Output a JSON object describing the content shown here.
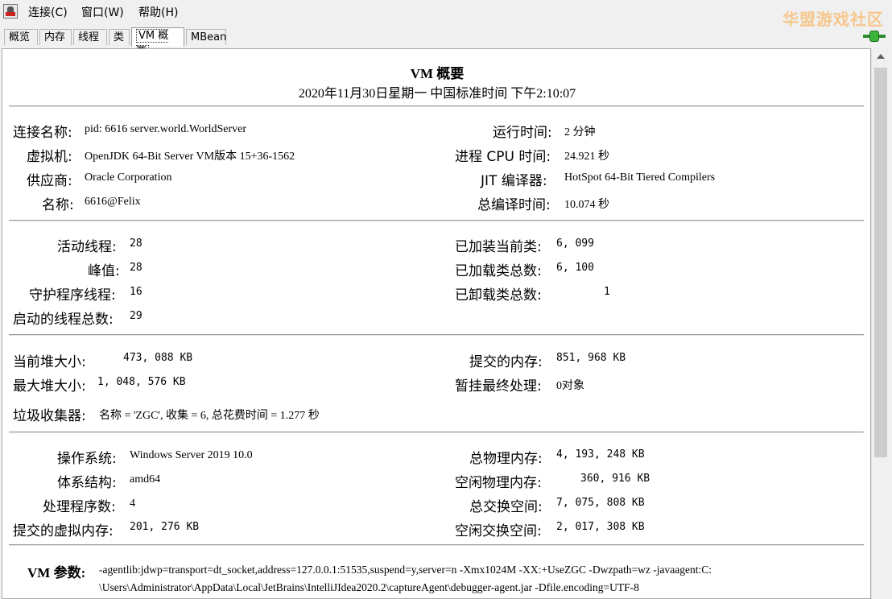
{
  "menu": {
    "items": [
      "连接(C)",
      "窗口(W)",
      "帮助(H)"
    ],
    "watermark": "华盟游戏社区"
  },
  "tabs": [
    "概览",
    "内存",
    "线程",
    "类",
    "VM 概要",
    "MBean"
  ],
  "active_tab": "VM 概要",
  "summary": {
    "title": "VM 概要",
    "timestamp": "2020年11月30日星期一 中国标准时间 下午2:10:07",
    "vm": {
      "connection_name_label": "连接名称:",
      "connection_name": "pid: 6616 server.world.WorldServer",
      "vm_label": "虚拟机:",
      "vm": "OpenJDK 64-Bit Server VM版本 15+36-1562",
      "vendor_label": "供应商:",
      "vendor": "Oracle Corporation",
      "name_label": "名称:",
      "name": "6616@Felix",
      "uptime_label": "运行时间:",
      "uptime": "2 分钟",
      "process_cpu_label": "进程 CPU 时间:",
      "process_cpu": "24.921 秒",
      "jit_label": "JIT 编译器:",
      "jit": "HotSpot 64-Bit Tiered Compilers",
      "compile_time_label": "总编译时间:",
      "compile_time": "10.074 秒"
    },
    "threads": {
      "live_label": "活动线程:",
      "live": "28",
      "peak_label": "峰值:",
      "peak": "28",
      "daemon_label": "守护程序线程:",
      "daemon": "16",
      "started_label": "启动的线程总数:",
      "started": "29",
      "loaded_label": "已加装当前类:",
      "loaded": "6, 099",
      "total_loaded_label": "已加载类总数:",
      "total_loaded": "6, 100",
      "unloaded_label": "已卸载类总数:",
      "unloaded": "1"
    },
    "memory": {
      "heap_label": "当前堆大小:",
      "heap": "473, 088 KB",
      "max_heap_label": "最大堆大小:",
      "max_heap": "1, 048, 576 KB",
      "committed_label": "提交的内存:",
      "committed": "851, 968 KB",
      "pending_label": "暂挂最终处理:",
      "pending": "0对象",
      "gc_label": "垃圾收集器:",
      "gc": "名称 = 'ZGC', 收集 = 6, 总花费时间 = 1.277 秒"
    },
    "os": {
      "os_label": "操作系统:",
      "os": "Windows Server 2019 10.0",
      "arch_label": "体系结构:",
      "arch": "amd64",
      "cpus_label": "处理程序数:",
      "cpus": "4",
      "vmem_label": "提交的虚拟内存:",
      "vmem": "201, 276 KB",
      "phys_label": "总物理内存:",
      "phys": "4, 193, 248 KB",
      "free_phys_label": "空闲物理内存:",
      "free_phys": "360, 916 KB",
      "swap_label": "总交换空间:",
      "swap": "7, 075, 808 KB",
      "free_swap_label": "空闲交换空间:",
      "free_swap": "2, 017, 308 KB"
    },
    "vm_args": {
      "label": "VM 参数:",
      "line1": "-agentlib:jdwp=transport=dt_socket,address=127.0.0.1:51535,suspend=y,server=n -Xmx1024M -XX:+UseZGC -Dwzpath=wz -javaagent:C:",
      "line2": "\\Users\\Administrator\\AppData\\Local\\JetBrains\\IntelliJIdea2020.2\\captureAgent\\debugger-agent.jar -Dfile.encoding=UTF-8"
    }
  }
}
